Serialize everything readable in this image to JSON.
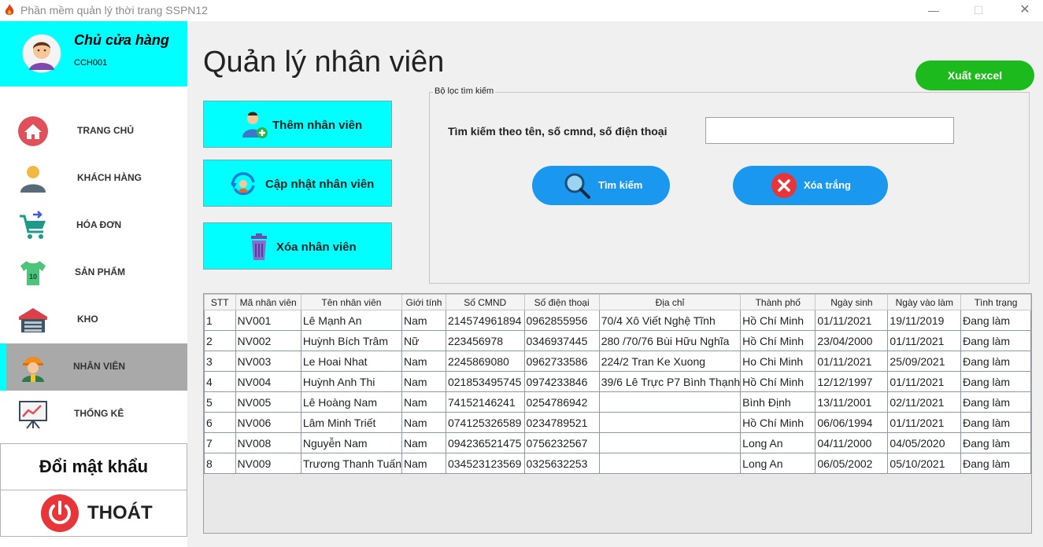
{
  "window": {
    "title": "Phần mềm quản lý thời trang SSPN12",
    "min": "—",
    "max": "☐",
    "close": "✕"
  },
  "profile": {
    "role": "Chủ cửa hàng",
    "code": "CCH001"
  },
  "nav": [
    {
      "label": "TRANG CHỦ",
      "icon": "home-icon"
    },
    {
      "label": "KHÁCH HÀNG",
      "icon": "customer-icon"
    },
    {
      "label": "HÓA ĐƠN",
      "icon": "cart-icon"
    },
    {
      "label": "SẢN PHẨM",
      "icon": "shirt-icon"
    },
    {
      "label": "KHO",
      "icon": "warehouse-icon"
    },
    {
      "label": "NHÂN VIÊN",
      "icon": "worker-icon",
      "active": true
    },
    {
      "label": "THỐNG KÊ",
      "icon": "chart-board-icon"
    }
  ],
  "sidebar_footer": {
    "change_password": "Đổi mật khẩu",
    "exit": "THOÁT"
  },
  "page_title": "Quản lý nhân viên",
  "actions": {
    "add": "Thêm nhân viên",
    "update": "Cập nhật nhân viên",
    "delete": "Xóa nhân viên",
    "export": "Xuất excel"
  },
  "filter": {
    "legend": "Bộ lọc tìm kiếm",
    "search_label": "Tìm kiếm theo tên, số cmnd, số điện thoại",
    "search_value": "",
    "search_button": "Tìm kiếm",
    "clear_button": "Xóa trắng"
  },
  "colors": {
    "accent_cyan": "#00ffff",
    "pill_blue": "#1a98f0",
    "export_green": "#1dba1d",
    "active_nav": "#a9a9a9"
  },
  "table": {
    "headers": [
      "STT",
      "Mã nhân viên",
      "Tên nhân viên",
      "Giới tính",
      "Số CMND",
      "Số điện thoại",
      "Địa chỉ",
      "Thành phố",
      "Ngày sinh",
      "Ngày vào làm",
      "Tình trạng"
    ],
    "rows": [
      [
        "1",
        "NV001",
        "Lê Mạnh An",
        "Nam",
        "214574961894",
        "0962855956",
        "70/4 Xô Viết Nghệ Tĩnh",
        "Hồ Chí Minh",
        "01/11/2021",
        "19/11/2019",
        "Đang làm"
      ],
      [
        "2",
        "NV002",
        "Huỳnh Bích Trâm",
        "Nữ",
        "223456978",
        "0346937445",
        "280 /70/76 Bùi Hữu Nghĩa",
        "Hồ Chí Minh",
        "23/04/2000",
        "01/11/2021",
        "Đang làm"
      ],
      [
        "3",
        "NV003",
        "Le Hoai Nhat",
        "Nam",
        "2245869080",
        "0962733586",
        "224/2 Tran Ke Xuong",
        "Ho Chi Minh",
        "01/11/2021",
        "25/09/2021",
        "Đang làm"
      ],
      [
        "4",
        "NV004",
        "Huỳnh Anh Thi",
        "Nam",
        "021853495745",
        "0974233846",
        "39/6 Lê Trực P7 Bình Thạnh",
        "Hồ Chí Minh",
        "12/12/1997",
        "01/11/2021",
        "Đang làm"
      ],
      [
        "5",
        "NV005",
        "Lê Hoàng Nam",
        "Nam",
        "74152146241",
        "0254786942",
        "",
        "Bình Định",
        "13/11/2001",
        "02/11/2021",
        "Đang làm"
      ],
      [
        "6",
        "NV006",
        "Lâm Minh Triết",
        "Nam",
        "074125326589",
        "0234789521",
        "",
        "Hồ Chí Minh",
        "06/06/1994",
        "01/11/2021",
        "Đang làm"
      ],
      [
        "7",
        "NV008",
        "Nguyễn Nam",
        "Nam",
        "094236521475",
        "0756232567",
        "",
        "Long An",
        "04/11/2000",
        "04/05/2020",
        "Đang làm"
      ],
      [
        "8",
        "NV009",
        "Trương Thanh Tuấn",
        "Nam",
        "034523123569",
        "0325632253",
        "",
        "Long An",
        "06/05/2002",
        "05/10/2021",
        "Đang làm"
      ]
    ]
  }
}
